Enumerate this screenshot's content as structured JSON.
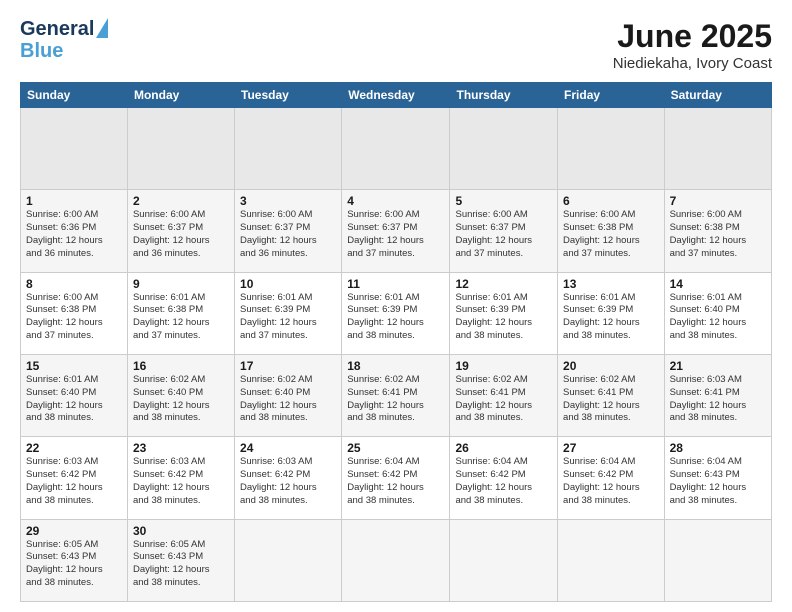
{
  "header": {
    "logo_general": "General",
    "logo_blue": "Blue",
    "title": "June 2025",
    "subtitle": "Niediekaha, Ivory Coast"
  },
  "calendar": {
    "days_of_week": [
      "Sunday",
      "Monday",
      "Tuesday",
      "Wednesday",
      "Thursday",
      "Friday",
      "Saturday"
    ],
    "weeks": [
      [
        {
          "day": "",
          "info": ""
        },
        {
          "day": "",
          "info": ""
        },
        {
          "day": "",
          "info": ""
        },
        {
          "day": "",
          "info": ""
        },
        {
          "day": "",
          "info": ""
        },
        {
          "day": "",
          "info": ""
        },
        {
          "day": "",
          "info": ""
        }
      ],
      [
        {
          "day": "1",
          "info": "Sunrise: 6:00 AM\nSunset: 6:36 PM\nDaylight: 12 hours\nand 36 minutes."
        },
        {
          "day": "2",
          "info": "Sunrise: 6:00 AM\nSunset: 6:37 PM\nDaylight: 12 hours\nand 36 minutes."
        },
        {
          "day": "3",
          "info": "Sunrise: 6:00 AM\nSunset: 6:37 PM\nDaylight: 12 hours\nand 36 minutes."
        },
        {
          "day": "4",
          "info": "Sunrise: 6:00 AM\nSunset: 6:37 PM\nDaylight: 12 hours\nand 37 minutes."
        },
        {
          "day": "5",
          "info": "Sunrise: 6:00 AM\nSunset: 6:37 PM\nDaylight: 12 hours\nand 37 minutes."
        },
        {
          "day": "6",
          "info": "Sunrise: 6:00 AM\nSunset: 6:38 PM\nDaylight: 12 hours\nand 37 minutes."
        },
        {
          "day": "7",
          "info": "Sunrise: 6:00 AM\nSunset: 6:38 PM\nDaylight: 12 hours\nand 37 minutes."
        }
      ],
      [
        {
          "day": "8",
          "info": "Sunrise: 6:00 AM\nSunset: 6:38 PM\nDaylight: 12 hours\nand 37 minutes."
        },
        {
          "day": "9",
          "info": "Sunrise: 6:01 AM\nSunset: 6:38 PM\nDaylight: 12 hours\nand 37 minutes."
        },
        {
          "day": "10",
          "info": "Sunrise: 6:01 AM\nSunset: 6:39 PM\nDaylight: 12 hours\nand 37 minutes."
        },
        {
          "day": "11",
          "info": "Sunrise: 6:01 AM\nSunset: 6:39 PM\nDaylight: 12 hours\nand 38 minutes."
        },
        {
          "day": "12",
          "info": "Sunrise: 6:01 AM\nSunset: 6:39 PM\nDaylight: 12 hours\nand 38 minutes."
        },
        {
          "day": "13",
          "info": "Sunrise: 6:01 AM\nSunset: 6:39 PM\nDaylight: 12 hours\nand 38 minutes."
        },
        {
          "day": "14",
          "info": "Sunrise: 6:01 AM\nSunset: 6:40 PM\nDaylight: 12 hours\nand 38 minutes."
        }
      ],
      [
        {
          "day": "15",
          "info": "Sunrise: 6:01 AM\nSunset: 6:40 PM\nDaylight: 12 hours\nand 38 minutes."
        },
        {
          "day": "16",
          "info": "Sunrise: 6:02 AM\nSunset: 6:40 PM\nDaylight: 12 hours\nand 38 minutes."
        },
        {
          "day": "17",
          "info": "Sunrise: 6:02 AM\nSunset: 6:40 PM\nDaylight: 12 hours\nand 38 minutes."
        },
        {
          "day": "18",
          "info": "Sunrise: 6:02 AM\nSunset: 6:41 PM\nDaylight: 12 hours\nand 38 minutes."
        },
        {
          "day": "19",
          "info": "Sunrise: 6:02 AM\nSunset: 6:41 PM\nDaylight: 12 hours\nand 38 minutes."
        },
        {
          "day": "20",
          "info": "Sunrise: 6:02 AM\nSunset: 6:41 PM\nDaylight: 12 hours\nand 38 minutes."
        },
        {
          "day": "21",
          "info": "Sunrise: 6:03 AM\nSunset: 6:41 PM\nDaylight: 12 hours\nand 38 minutes."
        }
      ],
      [
        {
          "day": "22",
          "info": "Sunrise: 6:03 AM\nSunset: 6:42 PM\nDaylight: 12 hours\nand 38 minutes."
        },
        {
          "day": "23",
          "info": "Sunrise: 6:03 AM\nSunset: 6:42 PM\nDaylight: 12 hours\nand 38 minutes."
        },
        {
          "day": "24",
          "info": "Sunrise: 6:03 AM\nSunset: 6:42 PM\nDaylight: 12 hours\nand 38 minutes."
        },
        {
          "day": "25",
          "info": "Sunrise: 6:04 AM\nSunset: 6:42 PM\nDaylight: 12 hours\nand 38 minutes."
        },
        {
          "day": "26",
          "info": "Sunrise: 6:04 AM\nSunset: 6:42 PM\nDaylight: 12 hours\nand 38 minutes."
        },
        {
          "day": "27",
          "info": "Sunrise: 6:04 AM\nSunset: 6:42 PM\nDaylight: 12 hours\nand 38 minutes."
        },
        {
          "day": "28",
          "info": "Sunrise: 6:04 AM\nSunset: 6:43 PM\nDaylight: 12 hours\nand 38 minutes."
        }
      ],
      [
        {
          "day": "29",
          "info": "Sunrise: 6:05 AM\nSunset: 6:43 PM\nDaylight: 12 hours\nand 38 minutes."
        },
        {
          "day": "30",
          "info": "Sunrise: 6:05 AM\nSunset: 6:43 PM\nDaylight: 12 hours\nand 38 minutes."
        },
        {
          "day": "",
          "info": ""
        },
        {
          "day": "",
          "info": ""
        },
        {
          "day": "",
          "info": ""
        },
        {
          "day": "",
          "info": ""
        },
        {
          "day": "",
          "info": ""
        }
      ]
    ]
  }
}
